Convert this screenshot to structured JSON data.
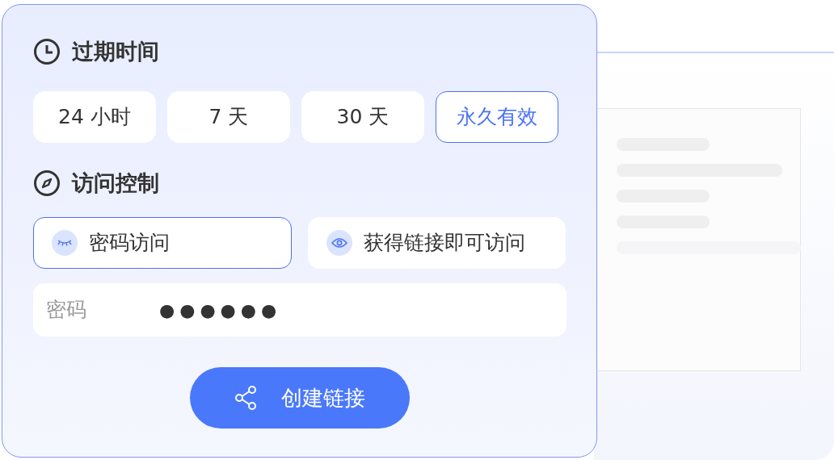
{
  "expiry": {
    "title": "过期时间",
    "options": [
      {
        "label": "24 小时",
        "selected": false
      },
      {
        "label": "7 天",
        "selected": false
      },
      {
        "label": "30 天",
        "selected": false
      },
      {
        "label": "永久有效",
        "selected": true
      }
    ]
  },
  "access": {
    "title": "访问控制",
    "options": [
      {
        "kind": "password",
        "label": "密码访问",
        "selected": true
      },
      {
        "kind": "link",
        "label": "获得链接即可访问",
        "selected": false
      }
    ]
  },
  "password": {
    "label": "密码",
    "value": "●●●●●●"
  },
  "create_button": {
    "label": "创建链接"
  }
}
